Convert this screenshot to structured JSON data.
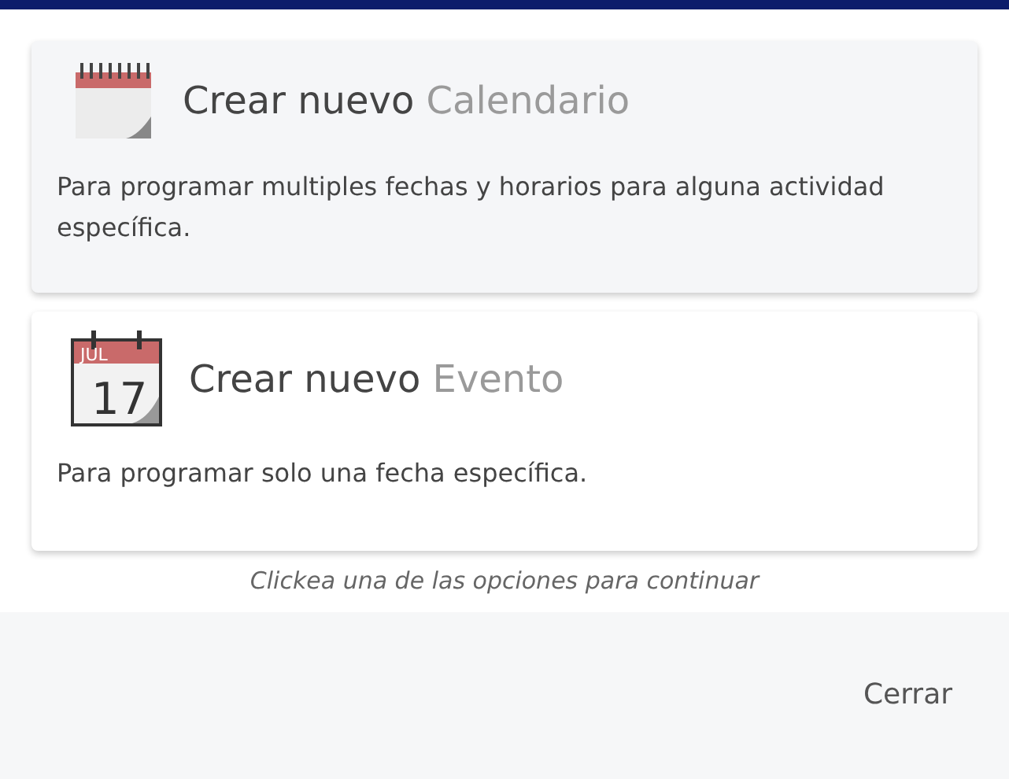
{
  "options": [
    {
      "kind": "calendar",
      "title": "Crear nuevo",
      "accent": "Calendario",
      "description": "Para programar multiples fechas y horarios para alguna actividad específica.",
      "selected": true
    },
    {
      "kind": "event",
      "title": "Crear nuevo",
      "accent": "Evento",
      "description": "Para programar solo una fecha específica.",
      "icon_month": "JUL",
      "icon_day": "17",
      "selected": false
    }
  ],
  "hint": "Clickea una de las opciones para continuar",
  "close_button": "Cerrar"
}
